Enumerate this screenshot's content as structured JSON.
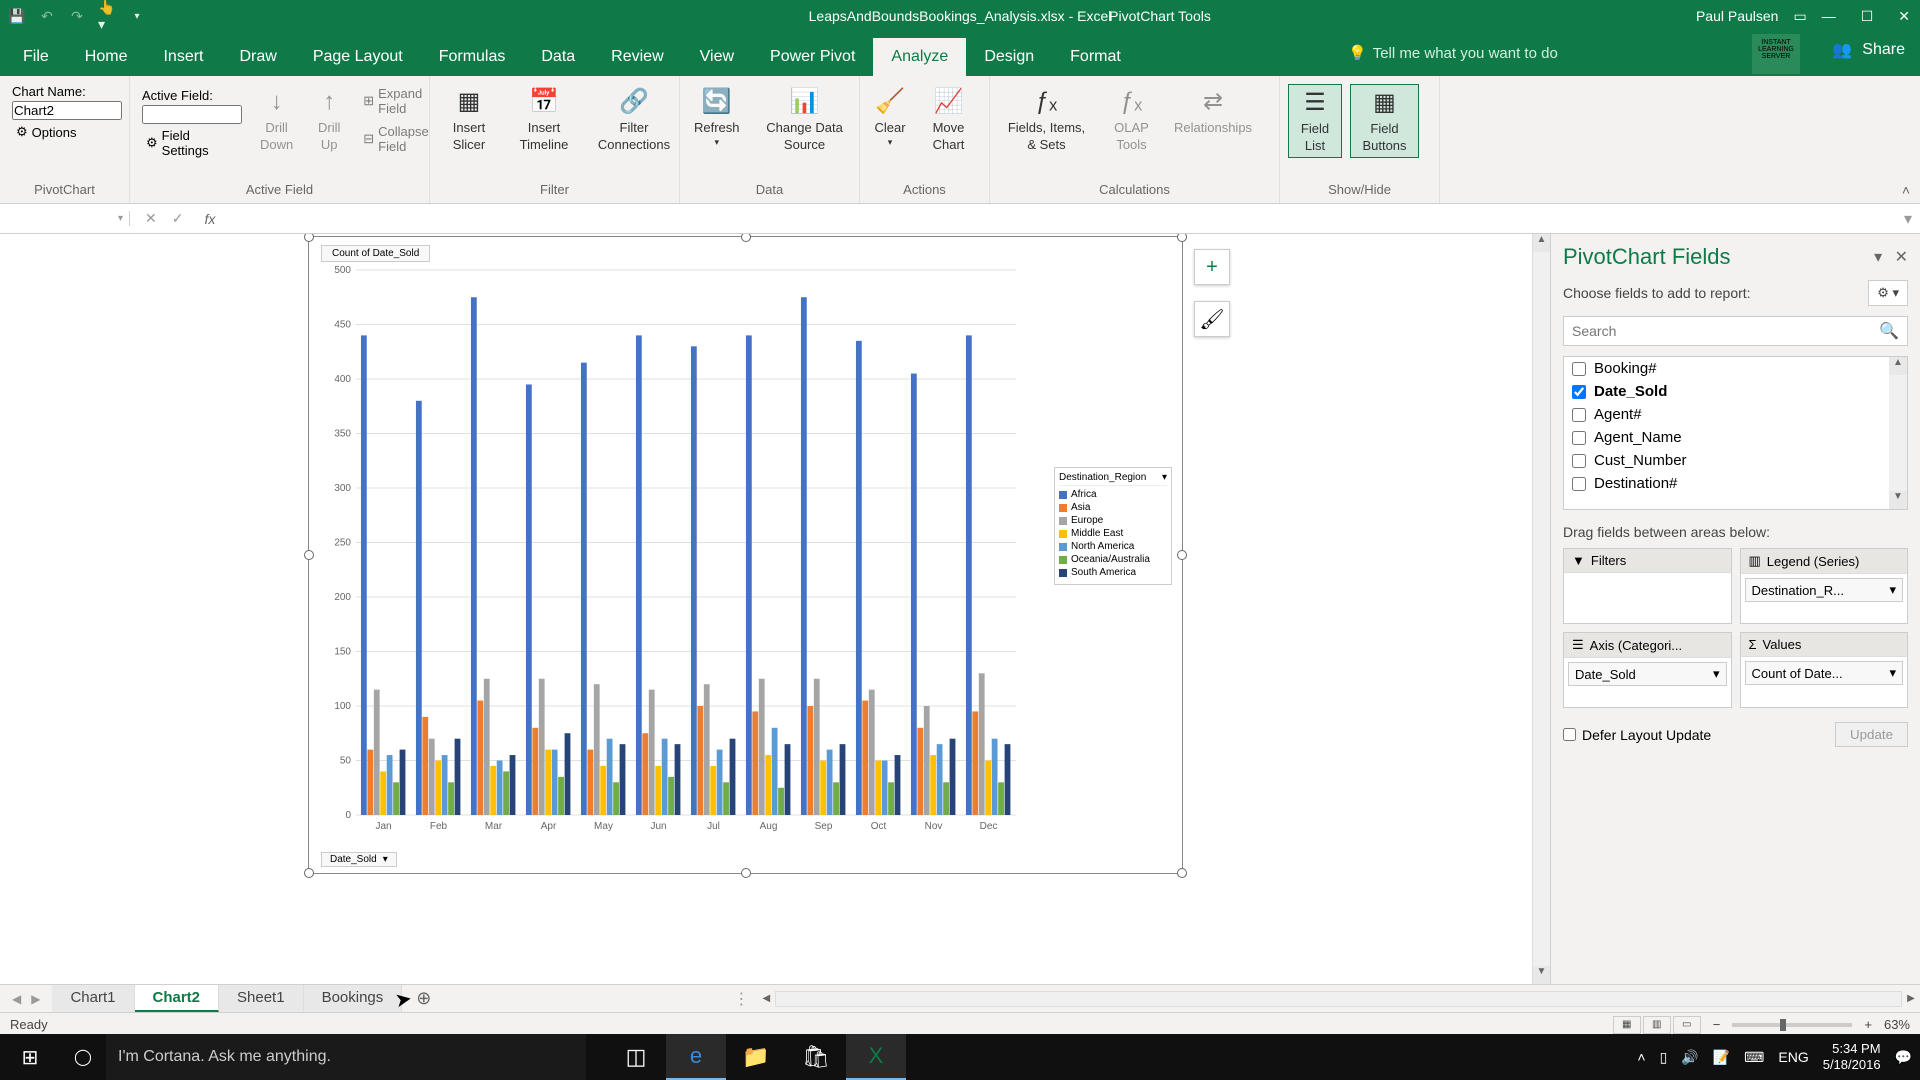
{
  "app": {
    "document_title": "LeapsAndBoundsBookings_Analysis.xlsx - Excel",
    "context_title": "PivotChart Tools",
    "user_name": "Paul Paulsen"
  },
  "ribbon": {
    "tabs": [
      "File",
      "Home",
      "Insert",
      "Draw",
      "Page Layout",
      "Formulas",
      "Data",
      "Review",
      "View",
      "Power Pivot",
      "Analyze",
      "Design",
      "Format"
    ],
    "tell_me": "Tell me what you want to do",
    "share": "Share",
    "groups": {
      "pivotchart": {
        "label": "PivotChart",
        "chart_name_label": "Chart Name:",
        "chart_name_value": "Chart2",
        "options": "Options"
      },
      "active_field": {
        "label": "Active Field",
        "field_label": "Active Field:",
        "field_value": "",
        "field_settings": "Field Settings",
        "drill_down": "Drill Down",
        "drill_up": "Drill Up",
        "expand": "Expand Field",
        "collapse": "Collapse Field"
      },
      "filter": {
        "label": "Filter",
        "insert_slicer": "Insert Slicer",
        "insert_timeline": "Insert Timeline",
        "filter_connections": "Filter Connections"
      },
      "data": {
        "label": "Data",
        "refresh": "Refresh",
        "change_source": "Change Data Source"
      },
      "actions": {
        "label": "Actions",
        "clear": "Clear",
        "move": "Move Chart"
      },
      "calculations": {
        "label": "Calculations",
        "fields_items": "Fields, Items, & Sets",
        "olap": "OLAP Tools",
        "relationships": "Relationships"
      },
      "showhide": {
        "label": "Show/Hide",
        "field_list": "Field List",
        "field_buttons": "Field Buttons"
      }
    }
  },
  "formula_bar": {
    "name_box": "",
    "formula": ""
  },
  "chart_data": {
    "type": "bar",
    "title": "Count of Date_Sold",
    "xlabel": "",
    "ylabel": "",
    "ylim": [
      0,
      500
    ],
    "yticks": [
      0,
      50,
      100,
      150,
      200,
      250,
      300,
      350,
      400,
      450,
      500
    ],
    "categories": [
      "Jan",
      "Feb",
      "Mar",
      "Apr",
      "May",
      "Jun",
      "Jul",
      "Aug",
      "Sep",
      "Oct",
      "Nov",
      "Dec"
    ],
    "series": [
      {
        "name": "Africa",
        "color": "#4472c4",
        "values": [
          440,
          380,
          475,
          395,
          415,
          440,
          430,
          440,
          475,
          435,
          405,
          440
        ]
      },
      {
        "name": "Asia",
        "color": "#ed7d31",
        "values": [
          60,
          90,
          105,
          80,
          60,
          75,
          100,
          95,
          100,
          105,
          80,
          95
        ]
      },
      {
        "name": "Europe",
        "color": "#a5a5a5",
        "values": [
          115,
          70,
          125,
          125,
          120,
          115,
          120,
          125,
          125,
          115,
          100,
          130
        ]
      },
      {
        "name": "Middle East",
        "color": "#ffc000",
        "values": [
          40,
          50,
          45,
          60,
          45,
          45,
          45,
          55,
          50,
          50,
          55,
          50
        ]
      },
      {
        "name": "North America",
        "color": "#5b9bd5",
        "values": [
          55,
          55,
          50,
          60,
          70,
          70,
          60,
          80,
          60,
          50,
          65,
          70
        ]
      },
      {
        "name": "Oceania/Australia",
        "color": "#70ad47",
        "values": [
          30,
          30,
          40,
          35,
          30,
          35,
          30,
          25,
          30,
          30,
          30,
          30
        ]
      },
      {
        "name": "South America",
        "color": "#264478",
        "values": [
          60,
          70,
          55,
          75,
          65,
          65,
          70,
          65,
          65,
          55,
          70,
          65
        ]
      }
    ],
    "legend_title": "Destination_Region",
    "axis_field": "Date_Sold"
  },
  "fields_pane": {
    "title": "PivotChart Fields",
    "subtitle": "Choose fields to add to report:",
    "search_placeholder": "Search",
    "fields": [
      {
        "name": "Booking#",
        "checked": false
      },
      {
        "name": "Date_Sold",
        "checked": true
      },
      {
        "name": "Agent#",
        "checked": false
      },
      {
        "name": "Agent_Name",
        "checked": false
      },
      {
        "name": "Cust_Number",
        "checked": false
      },
      {
        "name": "Destination#",
        "checked": false
      }
    ],
    "drag_label": "Drag fields between areas below:",
    "areas": {
      "filters": "Filters",
      "legend": "Legend (Series)",
      "legend_value": "Destination_R...",
      "axis": "Axis (Categori...",
      "axis_value": "Date_Sold",
      "values": "Values",
      "values_value": "Count of Date..."
    },
    "defer": "Defer Layout Update",
    "update": "Update"
  },
  "sheet_tabs": [
    "Chart1",
    "Chart2",
    "Sheet1",
    "Bookings"
  ],
  "active_sheet": "Chart2",
  "status": {
    "ready": "Ready",
    "zoom": "63%"
  },
  "taskbar": {
    "cortana": "I'm Cortana. Ask me anything.",
    "lang": "ENG",
    "time": "5:34 PM",
    "date": "5/18/2016"
  }
}
